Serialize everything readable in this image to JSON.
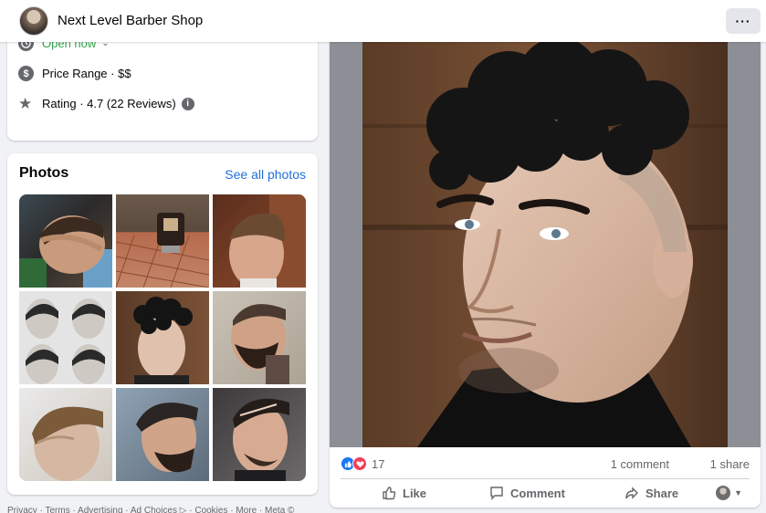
{
  "header": {
    "page_name": "Next Level Barber Shop",
    "more_label": "···"
  },
  "about": {
    "hours_status": "Open now",
    "price_range": "Price Range · $$",
    "rating": "Rating · 4.7 (22 Reviews)",
    "price_icon": "$",
    "info_icon": "i"
  },
  "photos": {
    "title": "Photos",
    "see_all": "See all photos"
  },
  "footer": {
    "links": "Privacy · Terms · Advertising · Ad Choices ▷ · Cookies · More · Meta ©"
  },
  "post": {
    "reaction_count": "17",
    "comments": "1 comment",
    "shares": "1 share",
    "actions": {
      "like": "Like",
      "comment": "Comment",
      "share": "Share"
    }
  },
  "colors": {
    "accent_blue": "#216fdb",
    "open_green": "#31a24c",
    "like_blue": "#1877f2",
    "love_red": "#f33e58"
  }
}
